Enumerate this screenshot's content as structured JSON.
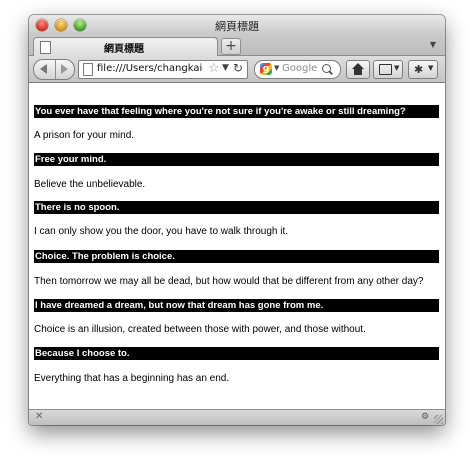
{
  "window": {
    "title": "網頁標題"
  },
  "tabs": [
    {
      "label": "網頁標題"
    }
  ],
  "toolbar": {
    "new_tab_label": "+",
    "url": "file:///Users/changkaic",
    "search_placeholder": "Google",
    "search_engine_letter": "g"
  },
  "icons": {
    "back": "back-arrow-icon",
    "forward": "forward-arrow-icon",
    "reload": "reload-icon",
    "star": "star-icon",
    "home": "home-icon",
    "bookmarks": "bookmarks-icon",
    "tools": "gear-icon",
    "close": "close-icon",
    "addon": "addon-icon"
  },
  "content": {
    "items": [
      {
        "question": "You ever have that feeling where you're not sure if you're awake or still dreaming?",
        "answer": "A prison for your mind."
      },
      {
        "question": "Free your mind.",
        "answer": "Believe the unbelievable."
      },
      {
        "question": "There is no spoon.",
        "answer": "I can only show you the door, you have to walk through it."
      },
      {
        "question": "Choice. The problem is choice.",
        "answer": "Then tomorrow we may all be dead, but how would that be different from any other day?"
      },
      {
        "question": "I have dreamed a dream, but now that dream has gone from me.",
        "answer": "Choice is an illusion, created between those with power, and those without."
      },
      {
        "question": "Because I choose to.",
        "answer": "Everything that has a beginning has an end."
      }
    ]
  },
  "colors": {
    "question_bg": "#000000",
    "question_text": "#ffffff",
    "answer_text": "#000000",
    "page_bg": "#ffffff"
  }
}
